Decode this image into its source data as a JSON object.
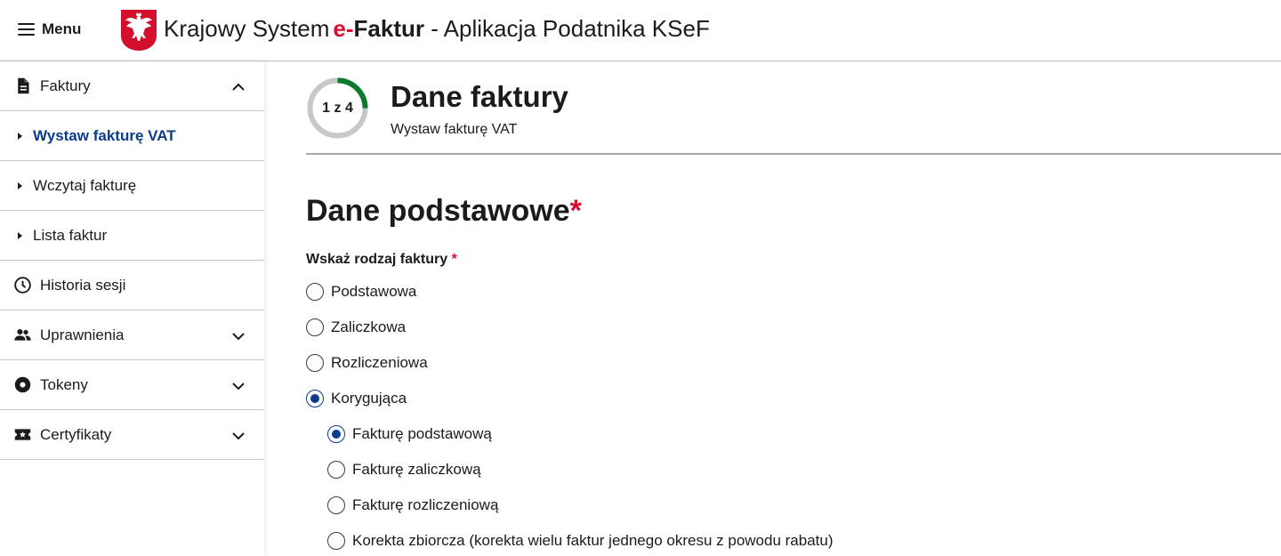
{
  "header": {
    "menu_label": "Menu",
    "title_part1": "Krajowy System",
    "title_e": "e-",
    "title_faktur": "Faktur",
    "title_part2": " - Aplikacja Podatnika KSeF"
  },
  "sidebar": {
    "faktury": {
      "label": "Faktury",
      "icon": "document-icon",
      "expanded": true
    },
    "sub_items": [
      {
        "label": "Wystaw fakturę VAT",
        "active": true
      },
      {
        "label": "Wczytaj fakturę",
        "active": false
      },
      {
        "label": "Lista faktur",
        "active": false
      }
    ],
    "items": [
      {
        "label": "Historia sesji",
        "icon": "clock-icon"
      },
      {
        "label": "Uprawnienia",
        "icon": "people-icon"
      },
      {
        "label": "Tokeny",
        "icon": "token-icon"
      },
      {
        "label": "Certyfikaty",
        "icon": "certificate-icon"
      }
    ]
  },
  "main": {
    "progress": {
      "text": "1 z 4",
      "current": 1,
      "total": 4,
      "color": "#0d7a2c"
    },
    "title": "Dane faktury",
    "subtitle": "Wystaw fakturę VAT",
    "section_title": "Dane podstawowe",
    "question": "Wskaż rodzaj faktury",
    "required_mark": "*",
    "options": [
      {
        "label": "Podstawowa",
        "checked": false
      },
      {
        "label": "Zaliczkowa",
        "checked": false
      },
      {
        "label": "Rozliczeniowa",
        "checked": false
      },
      {
        "label": "Korygująca",
        "checked": true
      }
    ],
    "sub_options": [
      {
        "label": "Fakturę podstawową",
        "checked": true
      },
      {
        "label": "Fakturę zaliczkową",
        "checked": false
      },
      {
        "label": "Fakturę rozliczeniową",
        "checked": false
      },
      {
        "label": "Korekta zbiorcza (korekta wielu faktur jednego okresu z powodu rabatu)",
        "checked": false
      }
    ]
  },
  "colors": {
    "accent_blue": "#0b3b8c",
    "required_red": "#d40f2e",
    "progress_green": "#0d7a2c"
  }
}
